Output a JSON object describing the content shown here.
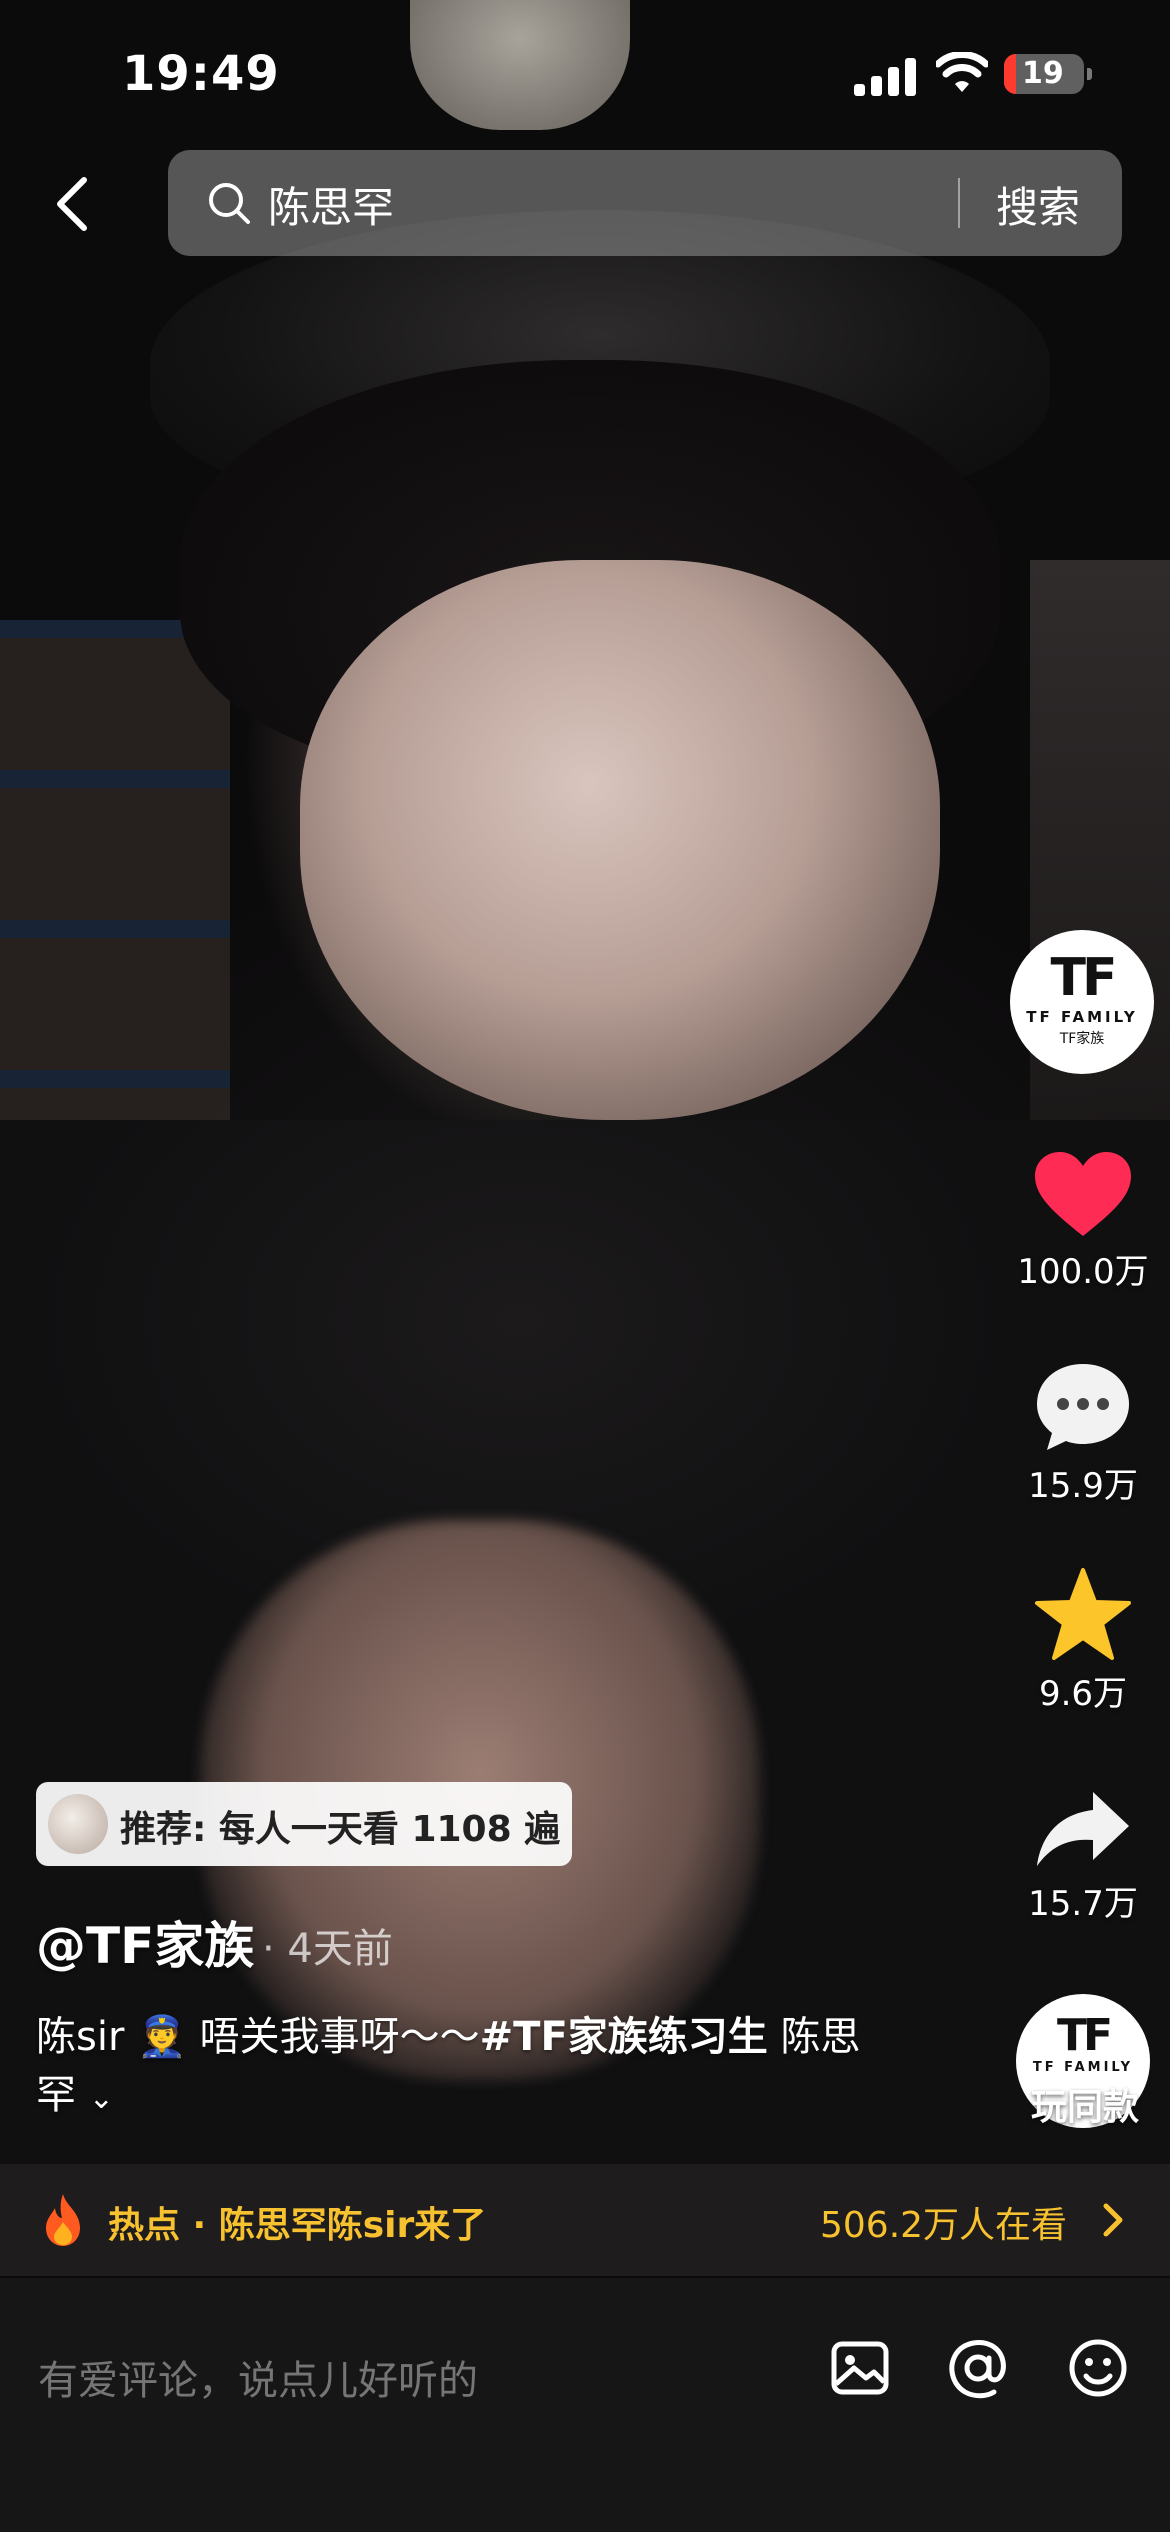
{
  "status_bar": {
    "time": "19:49",
    "battery": "19"
  },
  "search": {
    "query": "陈思罕",
    "button": "搜索"
  },
  "creator_avatar": {
    "logo": "TF",
    "line1": "TF FAMILY",
    "line2": "TF家族"
  },
  "actions": {
    "likes": "100.0万",
    "comments": "15.9万",
    "favorites": "9.6万",
    "shares": "15.7万",
    "same_style_label": "玩同款"
  },
  "recommend": {
    "text": "推荐: 每人一天看 1108 遍"
  },
  "post": {
    "author": "@TF家族",
    "time_ago": "· 4天前",
    "caption_prefix": "陈sir",
    "caption_emoji": "👮",
    "caption_text": "唔关我事呀～～",
    "caption_tag": "#TF家族练习生",
    "caption_suffix": "陈思罕"
  },
  "hot": {
    "label": "热点 · 陈思罕陈sir来了",
    "viewers": "506.2万人在看"
  },
  "comment_bar": {
    "placeholder": "有爱评论，说点儿好听的"
  },
  "colors": {
    "like": "#fe2c55",
    "star": "#fcc62a",
    "hot_text": "#f7c12f",
    "battery_low": "#ff3b30"
  }
}
